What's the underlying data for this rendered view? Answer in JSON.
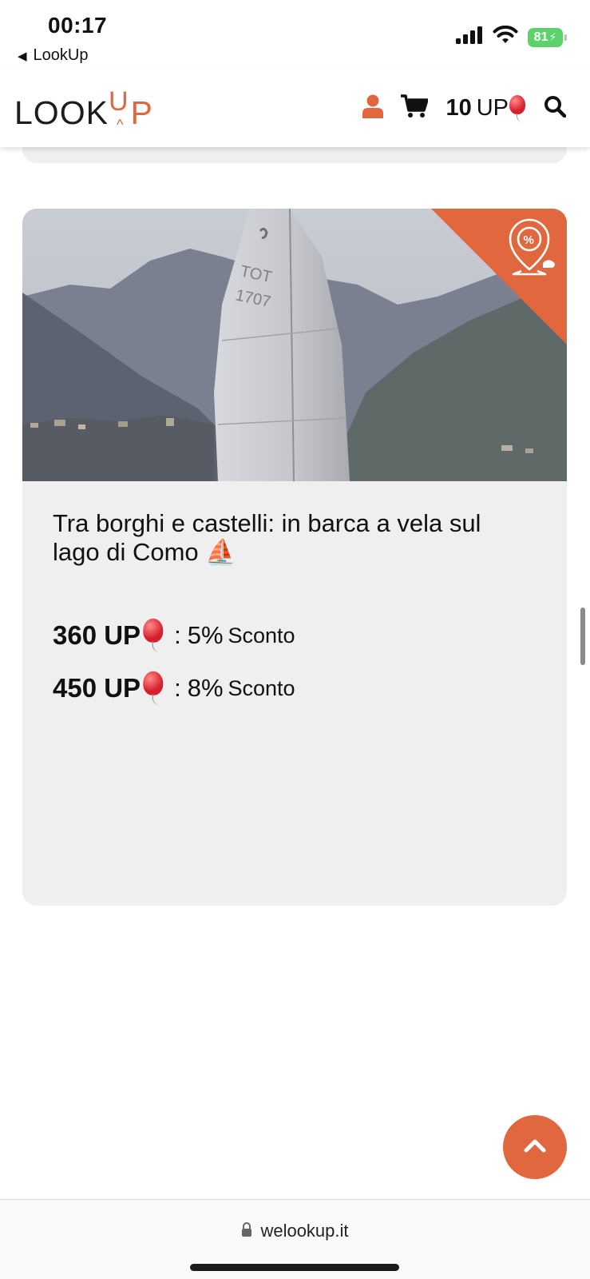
{
  "status_bar": {
    "time": "00:17",
    "back_label": "LookUp",
    "battery": "81"
  },
  "header": {
    "logo_look": "LOOK",
    "logo_u": "U",
    "logo_caret": "^",
    "logo_p": "P",
    "up_count": "10",
    "up_unit": "UP",
    "icons": [
      "user-icon",
      "cart-icon",
      "balloon-icon",
      "search-icon"
    ]
  },
  "card": {
    "title": "Tra borghi e castelli: in barca a vela sul lago di Como ⛵",
    "badge_icon": "location-discount-icon",
    "offers": [
      {
        "amount": "360 UP",
        "separator": ":",
        "percent": "5%",
        "word": "Sconto"
      },
      {
        "amount": "450 UP",
        "separator": ":",
        "percent": "8%",
        "word": "Sconto"
      }
    ]
  },
  "footer": {
    "url": "welookup.it"
  },
  "colors": {
    "accent": "#e0673e",
    "card_bg": "#efefef",
    "battery": "#5bd36a"
  }
}
